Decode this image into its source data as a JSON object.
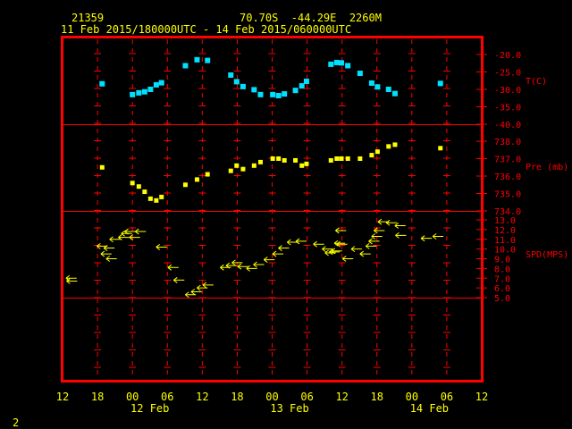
{
  "header": {
    "station": "21359",
    "location": "70.70S  -44.29E  2260M",
    "period": "11 Feb 2015/180000UTC - 14 Feb 2015/060000UTC"
  },
  "page_number": "2",
  "colors": {
    "frame": "#ff0000",
    "text": "#ffff00",
    "temperature": "#00e0ff",
    "pressure": "#ffff00",
    "wind": "#ffff00",
    "grid": "#ff0000"
  },
  "chart_data": {
    "type": "scatter",
    "x_unit": "hours since 11 Feb 2015 12:00 UTC",
    "x_range": [
      0,
      72
    ],
    "x_ticks": [
      "12",
      "18",
      "00",
      "06",
      "12",
      "18",
      "00",
      "06",
      "12",
      "18",
      "00",
      "06",
      "12"
    ],
    "x_day_labels": [
      {
        "label": "12 Feb",
        "at_hour": 15
      },
      {
        "label": "13 Feb",
        "at_hour": 39
      },
      {
        "label": "14 Feb",
        "at_hour": 63
      }
    ],
    "panels": [
      {
        "name": "temperature",
        "label": "T(C)",
        "ylim": [
          -40,
          -20
        ],
        "ticks": [
          "-20.0",
          "-25.0",
          "-30.0",
          "-35.0",
          "-40.0"
        ],
        "points": [
          [
            6.8,
            -28.4
          ],
          [
            12,
            -31.5
          ],
          [
            13.1,
            -31.0
          ],
          [
            14.1,
            -30.7
          ],
          [
            15.1,
            -30.0
          ],
          [
            16.1,
            -28.7
          ],
          [
            17,
            -28.1
          ],
          [
            21.1,
            -23.2
          ],
          [
            23.1,
            -21.5
          ],
          [
            24.9,
            -21.7
          ],
          [
            28.9,
            -25.9
          ],
          [
            29.9,
            -27.8
          ],
          [
            31,
            -29.2
          ],
          [
            32.9,
            -30.1
          ],
          [
            34,
            -31.5
          ],
          [
            36.1,
            -31.5
          ],
          [
            37.1,
            -31.8
          ],
          [
            38.1,
            -31.3
          ],
          [
            40,
            -30.3
          ],
          [
            41.1,
            -29.0
          ],
          [
            41.9,
            -27.7
          ],
          [
            46.1,
            -22.8
          ],
          [
            47.1,
            -22.3
          ],
          [
            47.9,
            -22.4
          ],
          [
            49,
            -23.2
          ],
          [
            51.1,
            -25.4
          ],
          [
            53.1,
            -28.2
          ],
          [
            54.1,
            -29.3
          ],
          [
            56,
            -30.0
          ],
          [
            57.1,
            -31.2
          ],
          [
            64.9,
            -28.3
          ]
        ]
      },
      {
        "name": "pressure",
        "label": "Pre (mb)",
        "ylim": [
          734,
          738
        ],
        "ticks": [
          "738.0",
          "737.0",
          "736.0",
          "735.0",
          "734.0"
        ],
        "points": [
          [
            6.8,
            736.5
          ],
          [
            12,
            735.6
          ],
          [
            13.1,
            735.4
          ],
          [
            14.1,
            735.1
          ],
          [
            15.1,
            734.7
          ],
          [
            16.1,
            734.6
          ],
          [
            17,
            734.8
          ],
          [
            21.1,
            735.5
          ],
          [
            23.1,
            735.8
          ],
          [
            24.9,
            736.1
          ],
          [
            28.9,
            736.3
          ],
          [
            29.9,
            736.6
          ],
          [
            31,
            736.4
          ],
          [
            32.9,
            736.6
          ],
          [
            34,
            736.8
          ],
          [
            36.1,
            737.0
          ],
          [
            37.1,
            737.0
          ],
          [
            38.1,
            736.9
          ],
          [
            40,
            736.9
          ],
          [
            41.1,
            736.6
          ],
          [
            41.9,
            736.7
          ],
          [
            46.1,
            736.9
          ],
          [
            47.1,
            737.0
          ],
          [
            47.9,
            737.0
          ],
          [
            49,
            737.0
          ],
          [
            51.1,
            737.0
          ],
          [
            53.1,
            737.2
          ],
          [
            54.1,
            737.4
          ],
          [
            56,
            737.7
          ],
          [
            57.1,
            737.8
          ],
          [
            64.9,
            737.6
          ]
        ]
      },
      {
        "name": "wind_speed",
        "label": "SPD(MPS)",
        "ylim": [
          5,
          13
        ],
        "ticks": [
          "13.0",
          "12.0",
          "11.0",
          "10.0",
          "9.0",
          "8.0",
          "7.0",
          "6.0",
          "5.0"
        ],
        "points": [
          [
            1.5,
            7.0
          ],
          [
            1.6,
            6.7
          ],
          [
            6.8,
            10.3
          ],
          [
            7.5,
            9.5
          ],
          [
            8,
            10.1
          ],
          [
            8.4,
            9.0
          ],
          [
            9,
            11.0
          ],
          [
            10.5,
            11.2
          ],
          [
            11,
            11.6
          ],
          [
            11.6,
            11.8
          ],
          [
            12.4,
            11.2
          ],
          [
            13.4,
            11.8
          ],
          [
            17,
            10.2
          ],
          [
            19,
            8.1
          ],
          [
            20,
            6.8
          ],
          [
            22,
            5.3
          ],
          [
            23,
            5.6
          ],
          [
            24,
            6.0
          ],
          [
            25,
            6.3
          ],
          [
            28,
            8.1
          ],
          [
            29,
            8.3
          ],
          [
            30,
            8.6
          ],
          [
            31,
            8.2
          ],
          [
            32.5,
            8.0
          ],
          [
            33.7,
            8.4
          ],
          [
            35.5,
            8.9
          ],
          [
            37,
            9.5
          ],
          [
            38,
            10.1
          ],
          [
            39.5,
            10.7
          ],
          [
            41,
            10.8
          ],
          [
            44,
            10.5
          ],
          [
            45.5,
            10.0
          ],
          [
            46,
            9.6
          ],
          [
            46.7,
            9.7
          ],
          [
            47.1,
            9.8
          ],
          [
            47.6,
            10.6
          ],
          [
            47.8,
            11.9
          ],
          [
            48,
            10.5
          ],
          [
            49,
            9.0
          ],
          [
            50.5,
            10.0
          ],
          [
            52,
            9.5
          ],
          [
            53,
            10.3
          ],
          [
            53.5,
            10.8
          ],
          [
            54,
            11.3
          ],
          [
            54.4,
            11.9
          ],
          [
            55.1,
            12.8
          ],
          [
            56.5,
            12.7
          ],
          [
            58,
            12.4
          ],
          [
            58.1,
            11.4
          ],
          [
            62.5,
            11.1
          ],
          [
            64.5,
            11.3
          ]
        ]
      }
    ]
  }
}
